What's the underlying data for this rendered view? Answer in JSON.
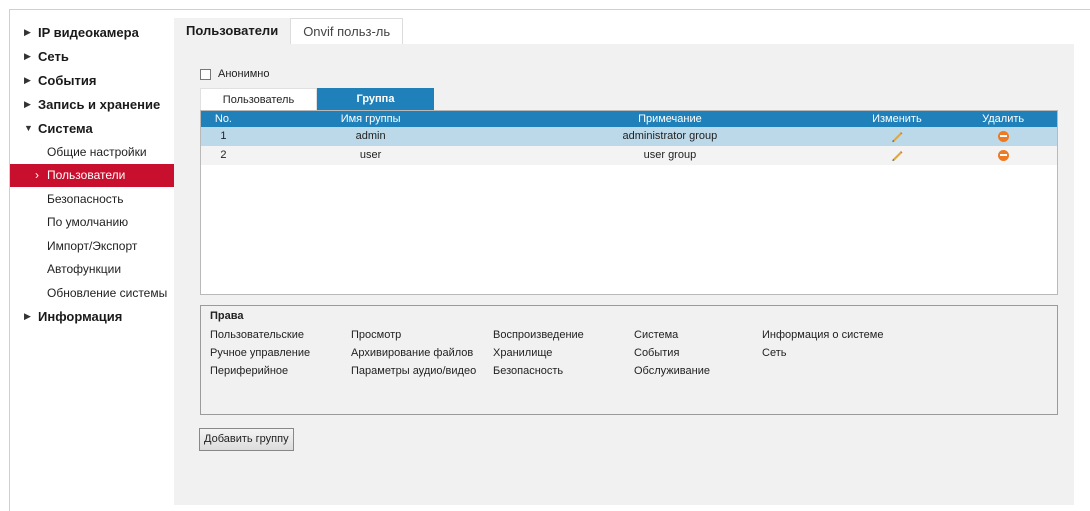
{
  "sidebar": {
    "top": [
      {
        "label": "IP видеокамера",
        "expanded": false
      },
      {
        "label": "Сеть",
        "expanded": false
      },
      {
        "label": "События",
        "expanded": false
      },
      {
        "label": "Запись и хранение",
        "expanded": false
      },
      {
        "label": "Система",
        "expanded": true
      }
    ],
    "system_items": [
      "Общие настройки",
      "Пользователи",
      "Безопасность",
      "По умолчанию",
      "Импорт/Экспорт",
      "Автофункции",
      "Обновление системы"
    ],
    "active_item": "Пользователи",
    "bottom": {
      "label": "Информация",
      "expanded": false
    },
    "active_color": "#c8102e"
  },
  "tabs": {
    "users": "Пользователи",
    "onvif": "Onvif польз-ль"
  },
  "anonymous": {
    "label": "Анонимно",
    "checked": false
  },
  "subtabs": {
    "user": "Пользователь",
    "group": "Группа"
  },
  "table": {
    "headers": {
      "no": "No.",
      "name": "Имя группы",
      "note": "Примечание",
      "edit": "Изменить",
      "delete": "Удалить"
    },
    "rows": [
      {
        "no": "1",
        "name": "admin",
        "note": "administrator group",
        "selected": true
      },
      {
        "no": "2",
        "name": "user",
        "note": "user group",
        "selected": false
      }
    ],
    "header_color": "#1f80ba"
  },
  "rights": {
    "title": "Права",
    "items": [
      [
        "Пользовательские",
        "Просмотр",
        "Воспроизведение",
        "Система",
        "Информация о системе"
      ],
      [
        "Ручное управление",
        "Архивирование файлов",
        "Хранилище",
        "События",
        "Сеть"
      ],
      [
        "Периферийное",
        "Параметры аудио/видео",
        "Безопасность",
        "Обслуживание",
        ""
      ]
    ]
  },
  "buttons": {
    "add_group": "Добавить группу"
  },
  "icons": {
    "edit": "pencil-icon",
    "delete": "delete-icon",
    "expand": "triangle-right-icon",
    "collapse": "triangle-down-icon"
  }
}
